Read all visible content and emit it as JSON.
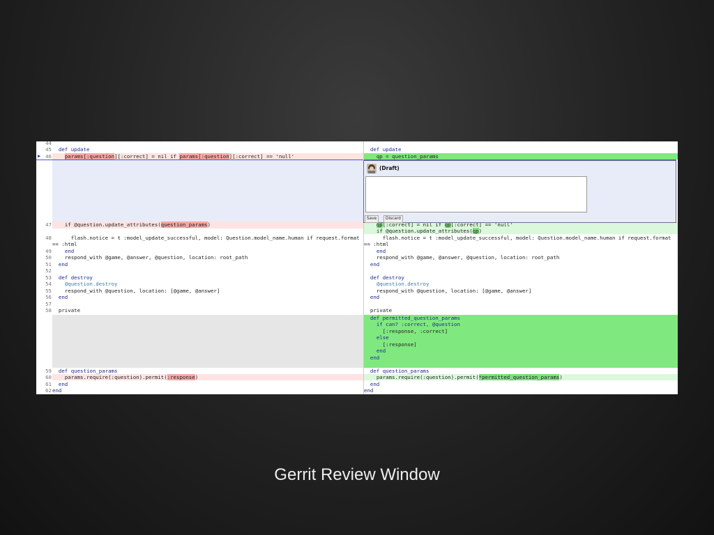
{
  "caption": "Gerrit Review Window",
  "colors": {
    "deleted_line_bg": "#fde3e3",
    "deleted_word_bg": "#f5a7a7",
    "added_line_bg": "#dcf8dc",
    "added_block_bg": "#7fe87f",
    "added_word_bg": "#7ce07c",
    "comment_area_bg": "#e8ecf8",
    "empty_filler_bg": "#e6e6e6"
  },
  "comment_box": {
    "status_label": "(Draft)",
    "text": "",
    "save_label": "Save",
    "discard_label": "Discard"
  },
  "line_numbers": {
    "l44": "44",
    "l45": "45",
    "l46": "46",
    "l47": "47",
    "l48": "48",
    "l49": "49",
    "l50": "50",
    "l51": "51",
    "l52": "52",
    "l53": "53",
    "l54": "54",
    "l55": "55",
    "l56": "56",
    "l57": "57",
    "l58": "58",
    "l59": "59",
    "l60": "60",
    "l61": "61",
    "l62": "62"
  },
  "left": {
    "l45": "def update",
    "l46_a": "params[",
    "l46_b": ":question",
    "l46_c": "][:correct] = nil if ",
    "l46_d": "params[:question",
    "l46_e": "][:correct] == 'null'",
    "l47_a": "if @question.update_attributes(",
    "l47_b": "question_params",
    "l47_c": ")",
    "l48a": "flash.notice = t :model_update_successful, model: Question.model_name.human if request.format",
    "l48b": "== :html",
    "l49": "end",
    "l50": "respond_with @game, @answer, @question, location: root_path",
    "l51": "end",
    "l53": "def destroy",
    "l54": "@question.destroy",
    "l55": "respond_with @question, location: [@game, @answer]",
    "l56": "end",
    "l58": "private",
    "l59": "def question_params",
    "l60_a": "params.require(:question).permit(",
    "l60_b": ":response",
    "l60_c": ")",
    "l61": "end",
    "l62": "end"
  },
  "right": {
    "r1": "def update",
    "r2_a": "qp = question",
    "r2_b": "_params",
    "r3_a": "qp",
    "r3_b": "[:correct] = nil if ",
    "r3_c": "qp",
    "r3_d": "[:correct] == 'null'",
    "r4_a": "if @question.update_attributes(",
    "r4_b": "qp",
    "r4_c": ")",
    "r5a": "flash.notice = t :model_update_successful, model: Question.model_name.human if request.format",
    "r5b": "== :html",
    "r6": "end",
    "r7": "respond_with @game, @answer, @question, location: root_path",
    "r8": "end",
    "r9": "def destroy",
    "r10": "@question.destroy",
    "r11": "respond_with @question, location: [@game, @answer]",
    "r12": "end",
    "r13": "private",
    "r14": "def permitted_question_params",
    "r15": "if can? :correct, @question",
    "r16": "[:response, :correct]",
    "r17": "else",
    "r18": "[:response]",
    "r19": "end",
    "r20": "end",
    "r21": "def question_params",
    "r22_a": "params.require(:question).permit(",
    "r22_b": "*permitted_question_params",
    "r22_c": ")",
    "r23": "end",
    "r24": "end"
  }
}
